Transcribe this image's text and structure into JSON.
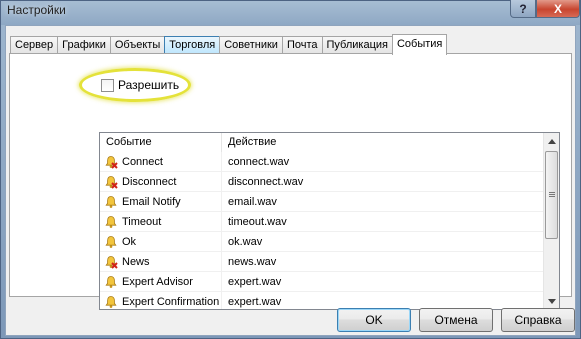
{
  "window": {
    "title": "Настройки",
    "help_label": "?",
    "close_label": "X"
  },
  "tabs": [
    {
      "label": "Сервер",
      "state": "normal"
    },
    {
      "label": "Графики",
      "state": "normal"
    },
    {
      "label": "Объекты",
      "state": "normal"
    },
    {
      "label": "Торговля",
      "state": "hover"
    },
    {
      "label": "Советники",
      "state": "normal"
    },
    {
      "label": "Почта",
      "state": "normal"
    },
    {
      "label": "Публикация",
      "state": "normal"
    },
    {
      "label": "События",
      "state": "active"
    }
  ],
  "events_tab": {
    "allow_label": "Разрешить",
    "allow_checked": false,
    "highlight_color": "#e4e23a",
    "columns": [
      "Событие",
      "Действие"
    ],
    "rows": [
      {
        "event": "Connect",
        "action": "connect.wav",
        "icon": "bell-disabled-icon"
      },
      {
        "event": "Disconnect",
        "action": "disconnect.wav",
        "icon": "bell-disabled-icon"
      },
      {
        "event": "Email Notify",
        "action": "email.wav",
        "icon": "bell-icon"
      },
      {
        "event": "Timeout",
        "action": "timeout.wav",
        "icon": "bell-icon"
      },
      {
        "event": "Ok",
        "action": "ok.wav",
        "icon": "bell-icon"
      },
      {
        "event": "News",
        "action": "news.wav",
        "icon": "bell-disabled-icon"
      },
      {
        "event": "Expert Advisor",
        "action": "expert.wav",
        "icon": "bell-icon"
      },
      {
        "event": "Expert Confirmation",
        "action": "expert.wav",
        "icon": "bell-icon"
      }
    ]
  },
  "buttons": {
    "ok": "OK",
    "cancel": "Отмена",
    "help": "Справка"
  }
}
